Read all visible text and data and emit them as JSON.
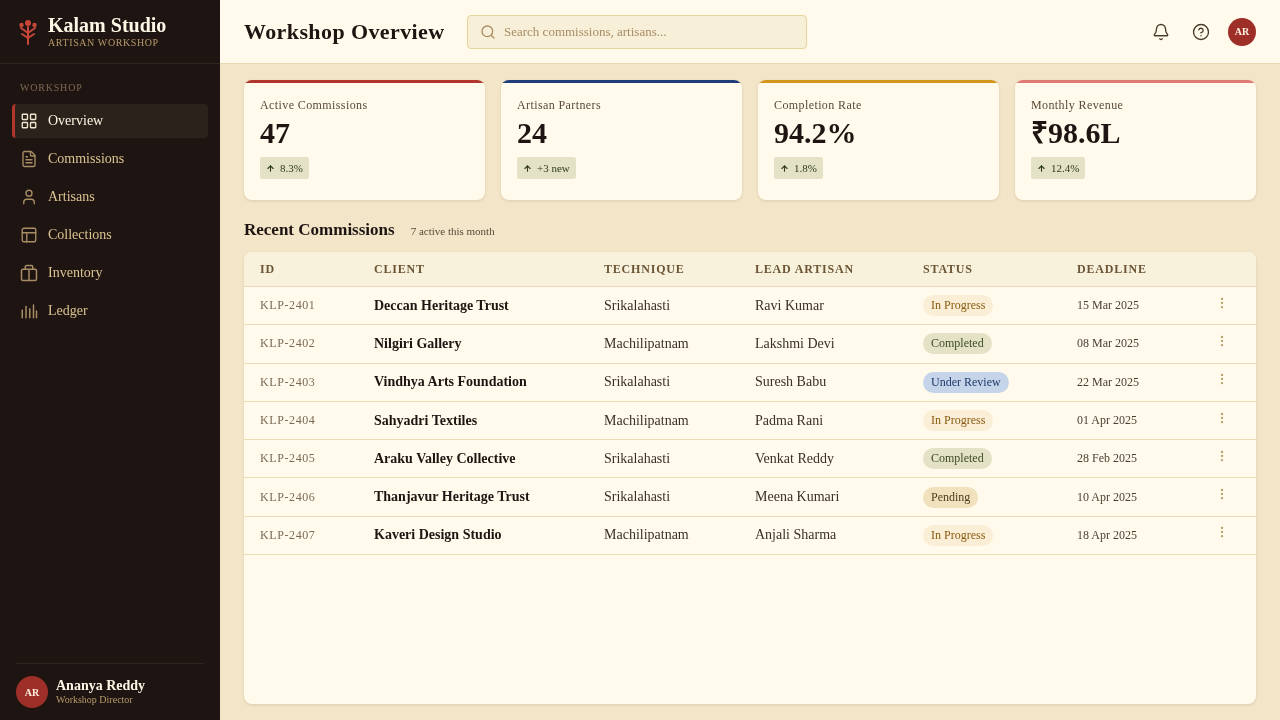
{
  "sidebar": {
    "brand": {
      "name": "Kalam Studio",
      "tagline": "ARTISAN WORKSHOP"
    },
    "section_label": "WORKSHOP",
    "items": [
      {
        "label": "Overview",
        "selected": true
      },
      {
        "label": "Commissions",
        "selected": false
      },
      {
        "label": "Artisans",
        "selected": false
      },
      {
        "label": "Collections",
        "selected": false
      },
      {
        "label": "Inventory",
        "selected": false
      },
      {
        "label": "Ledger",
        "selected": false
      }
    ],
    "user": {
      "initials": "AR",
      "name": "Ananya Reddy",
      "role": "Workshop Director"
    }
  },
  "header": {
    "title": "Workshop Overview",
    "search": {
      "placeholder": "Search commissions, artisans..."
    },
    "user_initials": "AR"
  },
  "stats": [
    {
      "label": "Active Commissions",
      "value": "47",
      "delta": "8.3%",
      "color": "#b0352a"
    },
    {
      "label": "Artisan Partners",
      "value": "24",
      "delta": "+3 new",
      "color": "#1f3c78"
    },
    {
      "label": "Completion Rate",
      "value": "94.2%",
      "delta": "1.8%",
      "color": "#d4951f"
    },
    {
      "label": "Monthly Revenue",
      "value": "₹98.6L",
      "delta": "12.4%",
      "color": "#e07a74"
    }
  ],
  "commissions": {
    "title": "Recent Commissions",
    "subtitle": "7 active this month",
    "columns": [
      "ID",
      "CLIENT",
      "TECHNIQUE",
      "LEAD ARTISAN",
      "STATUS",
      "DEADLINE"
    ],
    "rows": [
      {
        "id": "KLP-2401",
        "client": "Deccan Heritage Trust",
        "technique": "Srikalahasti",
        "lead_artisan": "Ravi Kumar",
        "status": {
          "label": "In Progress",
          "kind": "progress"
        },
        "deadline": "15 Mar 2025"
      },
      {
        "id": "KLP-2402",
        "client": "Nilgiri Gallery",
        "technique": "Machilipatnam",
        "lead_artisan": "Lakshmi Devi",
        "status": {
          "label": "Completed",
          "kind": "completed"
        },
        "deadline": "08 Mar 2025"
      },
      {
        "id": "KLP-2403",
        "client": "Vindhya Arts Foundation",
        "technique": "Srikalahasti",
        "lead_artisan": "Suresh Babu",
        "status": {
          "label": "Under Review",
          "kind": "review"
        },
        "deadline": "22 Mar 2025"
      },
      {
        "id": "KLP-2404",
        "client": "Sahyadri Textiles",
        "technique": "Machilipatnam",
        "lead_artisan": "Padma Rani",
        "status": {
          "label": "In Progress",
          "kind": "progress"
        },
        "deadline": "01 Apr 2025"
      },
      {
        "id": "KLP-2405",
        "client": "Araku Valley Collective",
        "technique": "Srikalahasti",
        "lead_artisan": "Venkat Reddy",
        "status": {
          "label": "Completed",
          "kind": "completed"
        },
        "deadline": "28 Feb 2025"
      },
      {
        "id": "KLP-2406",
        "client": "Thanjavur Heritage Trust",
        "technique": "Srikalahasti",
        "lead_artisan": "Meena Kumari",
        "status": {
          "label": "Pending",
          "kind": "pending"
        },
        "deadline": "10 Apr 2025"
      },
      {
        "id": "KLP-2407",
        "client": "Kaveri Design Studio",
        "technique": "Machilipatnam",
        "lead_artisan": "Anjali Sharma",
        "status": {
          "label": "In Progress",
          "kind": "progress"
        },
        "deadline": "18 Apr 2025"
      }
    ]
  }
}
